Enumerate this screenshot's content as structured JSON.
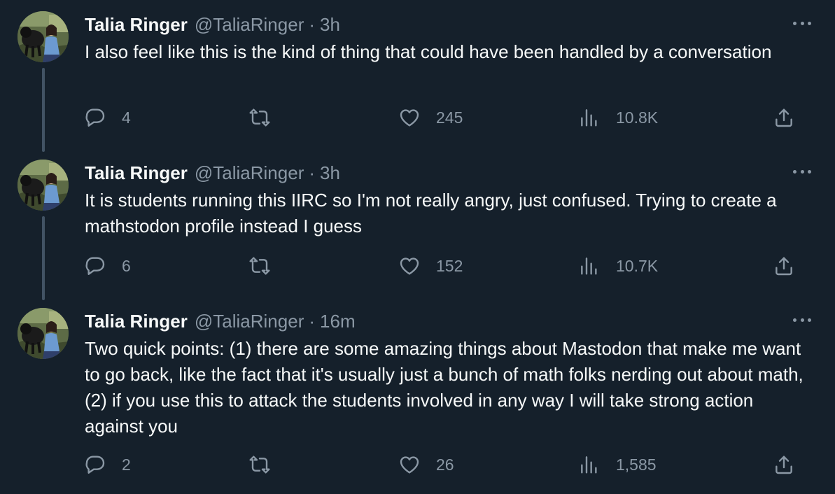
{
  "tweets": [
    {
      "name": "Talia Ringer",
      "handle": "@TaliaRinger",
      "dot": "·",
      "time": "3h",
      "text": "I also feel like this is the kind of thing that could have been handled by a conversation",
      "replies": "4",
      "likes": "245",
      "views": "10.8K"
    },
    {
      "name": "Talia Ringer",
      "handle": "@TaliaRinger",
      "dot": "·",
      "time": "3h",
      "text": "It is students running this IIRC so I'm not really angry, just confused. Trying to create a mathstodon profile instead I guess",
      "replies": "6",
      "likes": "152",
      "views": "10.7K"
    },
    {
      "name": "Talia Ringer",
      "handle": "@TaliaRinger",
      "dot": "·",
      "time": "16m",
      "text": "Two quick points: (1) there are some amazing things about Mastodon that make me want to go back, like the fact that it's usually just a bunch of math folks nerding out about math, (2) if you use this to attack the students involved in any way I will take strong action against you",
      "replies": "2",
      "likes": "26",
      "views": "1,585"
    }
  ],
  "icons": {
    "reply": "speech-bubble",
    "retweet": "repost-arrows",
    "like": "heart",
    "views": "bar-chart",
    "share": "upload-arrow",
    "more": "ellipsis"
  },
  "colors": {
    "background": "#15202b",
    "primary_text": "#f7f9f9",
    "secondary_text": "#8b98a5",
    "thread_line": "#425364"
  }
}
